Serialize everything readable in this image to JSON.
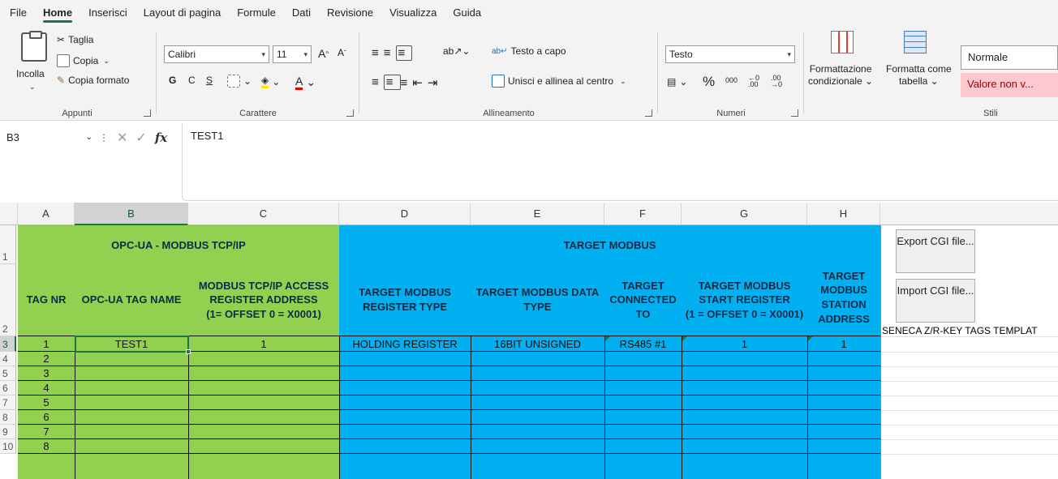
{
  "menu": [
    "File",
    "Home",
    "Inserisci",
    "Layout di pagina",
    "Formule",
    "Dati",
    "Revisione",
    "Visualizza",
    "Guida"
  ],
  "ribbon": {
    "appunti": {
      "paste": "Incolla",
      "cut": "Taglia",
      "copy": "Copia",
      "format_painter": "Copia formato",
      "label": "Appunti"
    },
    "carattere": {
      "font": "Calibri",
      "size": "11",
      "bold": "G",
      "italic": "C",
      "underline": "S",
      "label": "Carattere"
    },
    "allineamento": {
      "wrap": "Testo a capo",
      "merge": "Unisci e allinea al centro",
      "label": "Allineamento"
    },
    "numeri": {
      "format": "Testo",
      "label": "Numeri"
    },
    "stili": {
      "cond_format": "Formattazione",
      "cond_format2": "condizionale",
      "table_format": "Formatta come",
      "table_format2": "tabella",
      "normal": "Normale",
      "bad": "Valore non v...",
      "label": "Stili"
    }
  },
  "formula_bar": {
    "name_box": "B3",
    "content": "TEST1"
  },
  "columns": [
    "A",
    "B",
    "C",
    "D",
    "E",
    "F",
    "G",
    "H"
  ],
  "rows": [
    "1",
    "2",
    "3",
    "4",
    "5",
    "6",
    "7",
    "8",
    "9",
    "10"
  ],
  "sheet": {
    "group_left": "OPC-UA - MODBUS TCP/IP",
    "group_right": "TARGET MODBUS",
    "headers": {
      "a": "TAG NR",
      "b": "OPC-UA TAG NAME",
      "c1": "MODBUS TCP/IP ACCESS",
      "c2": "REGISTER ADDRESS",
      "c3": "(1= OFFSET 0 = X0001)",
      "d1": "TARGET MODBUS",
      "d2": "REGISTER TYPE",
      "e1": "TARGET MODBUS DATA",
      "e2": "TYPE",
      "f1": "TARGET",
      "f2": "CONNECTED",
      "f3": "TO",
      "g1": "TARGET MODBUS",
      "g2": "START REGISTER",
      "g3": "(1 = OFFSET 0 = X0001)",
      "h1": "TARGET",
      "h2": "MODBUS",
      "h3": "STATION",
      "h4": "ADDRESS"
    },
    "row3": {
      "a": "1",
      "b": "TEST1",
      "c": "1",
      "d": "HOLDING REGISTER",
      "e": "16BIT UNSIGNED",
      "f": "RS485 #1",
      "g": "1",
      "h": "1"
    },
    "tag_numbers": [
      "2",
      "3",
      "4",
      "5",
      "6",
      "7",
      "8"
    ],
    "export_button": "Export CGI file...",
    "import_button": "Import CGI file...",
    "template_label": "SENECA Z/R-KEY TAGS TEMPLAT"
  },
  "colors": {
    "green": "#92d050",
    "blue": "#00b0f0",
    "excel_green": "#217346"
  }
}
